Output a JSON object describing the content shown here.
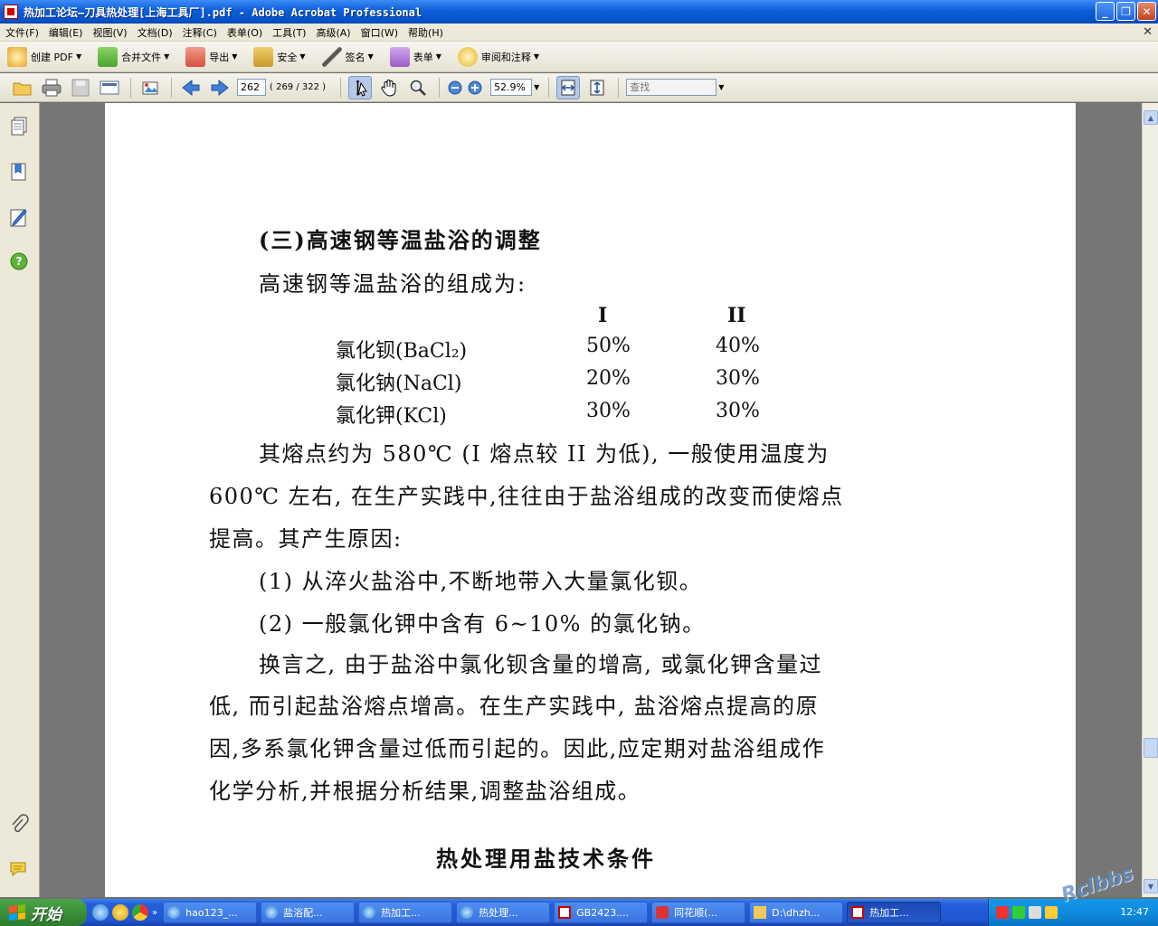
{
  "window": {
    "title": "热加工论坛—刀具热处理[上海工具厂].pdf - Adobe Acrobat Professional",
    "controls": [
      "_",
      "❐",
      "✕"
    ]
  },
  "menu": [
    {
      "label": "文件(F)"
    },
    {
      "label": "编辑(E)"
    },
    {
      "label": "视图(V)"
    },
    {
      "label": "文档(D)"
    },
    {
      "label": "注释(C)"
    },
    {
      "label": "表单(O)"
    },
    {
      "label": "工具(T)"
    },
    {
      "label": "高级(A)"
    },
    {
      "label": "窗口(W)"
    },
    {
      "label": "帮助(H)"
    }
  ],
  "tasks": [
    {
      "label": "创建 PDF",
      "icon": "create-pdf-icon",
      "color": "#e8a42a"
    },
    {
      "label": "合并文件",
      "icon": "combine-files-icon",
      "color": "#4aa52e"
    },
    {
      "label": "导出",
      "icon": "export-icon",
      "color": "#d94f3d"
    },
    {
      "label": "安全",
      "icon": "lock-icon",
      "color": "#c89a2a"
    },
    {
      "label": "签名",
      "icon": "pen-icon",
      "color": "#555555"
    },
    {
      "label": "表单",
      "icon": "form-icon",
      "color": "#9b5cc7"
    },
    {
      "label": "审阅和注释",
      "icon": "comment-icon",
      "color": "#e8b42a"
    }
  ],
  "nav": {
    "page_current": "262",
    "page_count": "( 269 / 322 )",
    "zoom": "52.9%",
    "find_placeholder": "查找"
  },
  "document": {
    "subheading": "(三)高速钢等温盐浴的调整",
    "intro": "高速钢等温盐浴的组成为:",
    "columns": [
      "I",
      "II"
    ],
    "rows": [
      {
        "name": "氯化钡(BaCl₂)",
        "c1": "50%",
        "c2": "40%"
      },
      {
        "name": "氯化钠(NaCl)",
        "c1": "20%",
        "c2": "30%"
      },
      {
        "name": "氯化钾(KCl)",
        "c1": "30%",
        "c2": "30%"
      }
    ],
    "para1": [
      "其熔点约为 580℃ (I 熔点较 II 为低), 一般使用温度为",
      "600℃ 左右, 在生产实践中,往往由于盐浴组成的改变而使熔点",
      "提高。其产生原因:"
    ],
    "item1": "(1)  从淬火盐浴中,不断地带入大量氯化钡。",
    "item2": "(2)  一般氯化钾中含有 6~10% 的氯化钠。",
    "para2": [
      "换言之, 由于盐浴中氯化钡含量的增高, 或氯化钾含量过",
      "低, 而引起盐浴熔点增高。在生产实践中, 盐浴熔点提高的原",
      "因,多系氯化钾含量过低而引起的。因此,应定期对盐浴组成作",
      "化学分析,并根据分析结果,调整盐浴组成。"
    ],
    "section_title": "热处理用盐技术条件"
  },
  "taskbar": {
    "start_label": "开始",
    "buttons": [
      {
        "label": "hao123_...",
        "icon": "ie-icon"
      },
      {
        "label": "盐浴配...",
        "icon": "ie-icon"
      },
      {
        "label": "热加工...",
        "icon": "ie-icon"
      },
      {
        "label": "热处理...",
        "icon": "ie-icon"
      },
      {
        "label": "GB2423....",
        "icon": "pdf-icon"
      },
      {
        "label": "同花顺(...",
        "icon": "app-icon"
      },
      {
        "label": "D:\\dhzh...",
        "icon": "folder-icon"
      },
      {
        "label": "热加工...",
        "icon": "pdf-icon"
      }
    ],
    "clock": "12:47",
    "watermark": "Rclbbs"
  }
}
